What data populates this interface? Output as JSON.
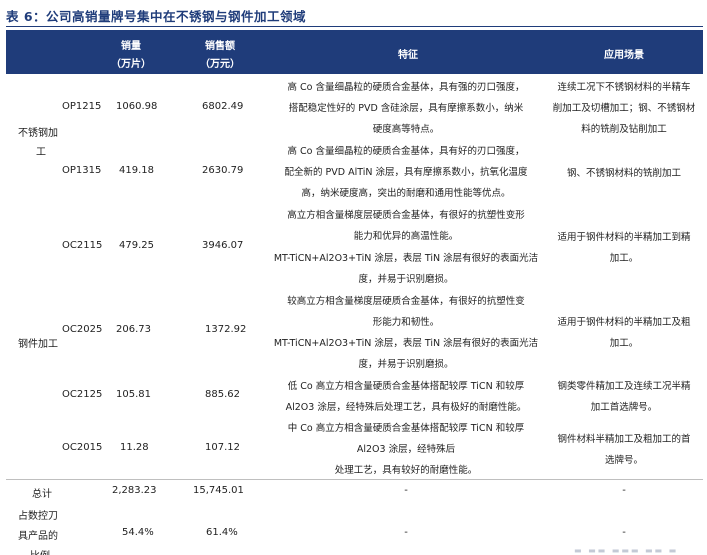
{
  "title": "表 6：公司高销量牌号集中在不锈钢与钢件加工领域",
  "header": {
    "sales_volume": "销量",
    "sales_volume_unit": "（万片）",
    "sales_amount": "销售额",
    "sales_amount_unit": "（万元）",
    "feature": "特征",
    "application": "应用场景"
  },
  "groups": {
    "stainless_line1": "不锈钢加",
    "stainless_line2": "工",
    "steel": "钢件加工"
  },
  "rows": [
    {
      "grade": "OP1215",
      "volume": "1060.98",
      "amount": "6802.49",
      "desc": [
        "高 Co 含量细晶粒的硬质合金基体，具有强的刃口强度，",
        "搭配稳定性好的 PVD 含硅涂层，具有摩擦系数小，纳米",
        "硬度高等特点。"
      ],
      "app": [
        "连续工况下不锈钢材料的半精车",
        "削加工及切槽加工；钢、不锈钢材",
        "料的铣削及钻削加工"
      ]
    },
    {
      "grade": "OP1315",
      "volume": "419.18",
      "amount": "2630.79",
      "desc": [
        "高 Co 含量细晶粒的硬质合金基体，具有好的刃口强度，",
        "配全新的 PVD AlTiN 涂层，具有摩擦系数小，抗氧化温度",
        "高，纳米硬度高，突出的耐磨和通用性能等优点。"
      ],
      "app": [
        "钢、不锈钢材料的铣削加工"
      ]
    },
    {
      "grade": "OC2115",
      "volume": "479.25",
      "amount": "3946.07",
      "desc": [
        "高立方相含量梯度层硬质合金基体，有很好的抗塑性变形",
        "能力和优异的高温性能。",
        "MT-TiCN+Al2O3+TiN 涂层，表层 TiN 涂层有很好的表面光洁",
        "度，并易于识别磨损。"
      ],
      "app": [
        "适用于钢件材料的半精加工到精",
        "加工。"
      ]
    },
    {
      "grade": "OC2025",
      "volume": "206.73",
      "amount": "1372.92",
      "desc": [
        "较高立方相含量梯度层硬质合金基体，有很好的抗塑性变",
        "形能力和韧性。",
        "MT-TiCN+Al2O3+TiN 涂层，表层 TiN 涂层有很好的表面光洁",
        "度，并易于识别磨损。"
      ],
      "app": [
        "适用于钢件材料的半精加工及粗",
        "加工。"
      ]
    },
    {
      "grade": "OC2125",
      "volume": "105.81",
      "amount": "885.62",
      "desc": [
        "低 Co 高立方相含量硬质合金基体搭配较厚 TiCN 和较厚",
        "Al2O3 涂层，经特殊后处理工艺，具有极好的耐磨性能。"
      ],
      "app": [
        "钢类零件精加工及连续工况半精",
        "加工首选牌号。"
      ]
    },
    {
      "grade": "OC2015",
      "volume": "11.28",
      "amount": "107.12",
      "desc": [
        "中 Co 高立方相含量硬质合金基体搭配较厚 TiCN 和较厚",
        "Al2O3 涂层，经特殊后",
        "处理工艺，具有较好的耐磨性能。"
      ],
      "app": [
        "钢件材料半精加工及粗加工的首",
        "选牌号。"
      ]
    }
  ],
  "total": {
    "label": "总计",
    "volume": "2,283.23",
    "amount": "15,745.01",
    "feature": "-",
    "app": "-"
  },
  "share": {
    "label_line1": "占数控刀",
    "label_line2": "具产品的",
    "label_line3": "比例",
    "volume": "54.4%",
    "amount": "61.4%",
    "feature": "-",
    "app": "-"
  }
}
